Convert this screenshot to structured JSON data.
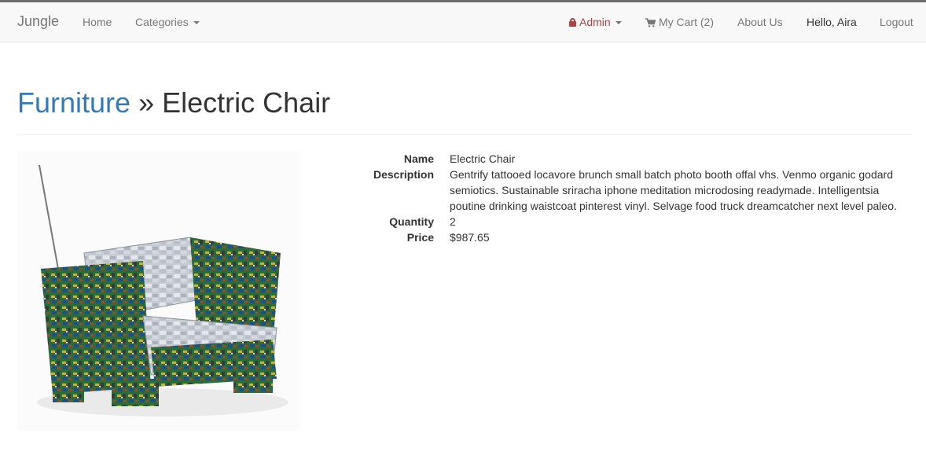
{
  "navbar": {
    "brand": "Jungle",
    "home": "Home",
    "categories": "Categories",
    "admin": "Admin",
    "cart": "My Cart (2)",
    "about": "About Us",
    "greeting": "Hello, Aira",
    "logout": "Logout"
  },
  "header": {
    "category": "Furniture",
    "separator": "»",
    "product": "Electric Chair"
  },
  "product": {
    "image_alt": "Electric Chair",
    "fields": [
      {
        "label": "Name",
        "value": "Electric Chair"
      },
      {
        "label": "Description",
        "value": "Gentrify tattooed locavore brunch small batch photo booth offal vhs. Venmo organic godard semiotics. Sustainable sriracha iphone meditation microdosing readymade. Intelligentsia poutine drinking waistcoat pinterest vinyl. Selvage food truck dreamcatcher next level paleo."
      },
      {
        "label": "Quantity",
        "value": "2"
      },
      {
        "label": "Price",
        "value": "$987.65"
      }
    ]
  },
  "colors": {
    "link": "#337ab7",
    "admin": "#a94442",
    "navbar_bg": "#f8f8f8"
  }
}
